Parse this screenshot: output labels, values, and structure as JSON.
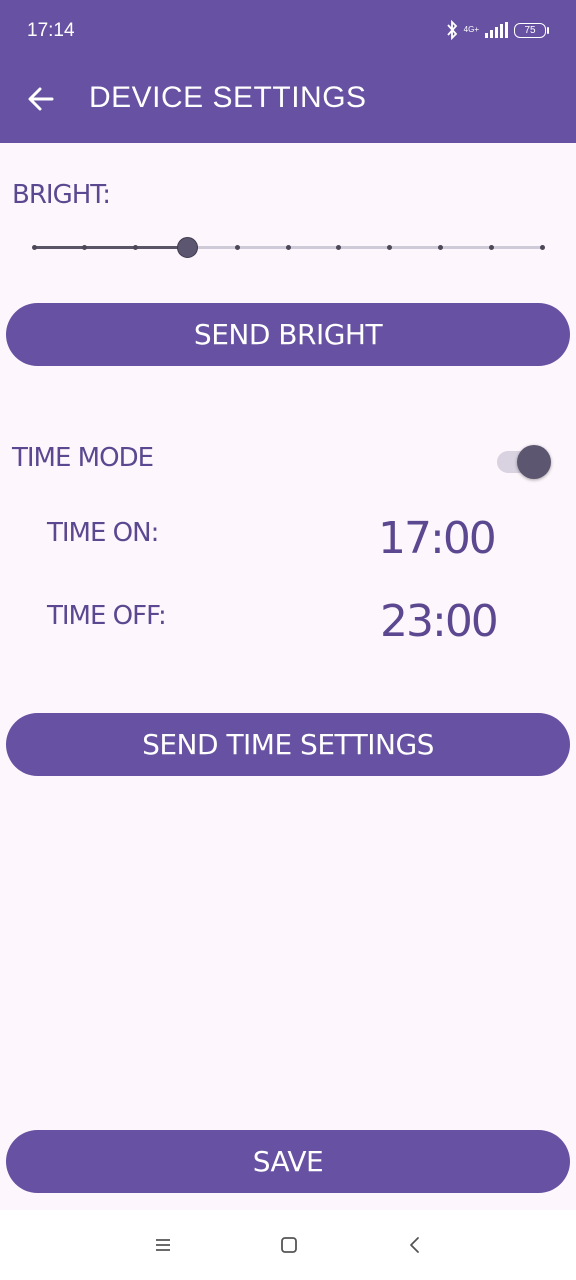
{
  "status_bar": {
    "time": "17:14",
    "network": "4G+",
    "battery": "75",
    "icons": [
      "bluetooth-icon",
      "signal-icon",
      "battery-icon"
    ]
  },
  "app_bar": {
    "title": "DEVICE SETTINGS",
    "back_icon": "arrow-left-icon"
  },
  "bright": {
    "label": "BRIGHT:",
    "steps": 11,
    "value_index": 3
  },
  "send_bright_button": "SEND BRIGHT",
  "time_mode": {
    "label": "TIME MODE",
    "enabled": true
  },
  "time_on": {
    "label": "TIME ON:",
    "value": "17:00"
  },
  "time_off": {
    "label": "TIME OFF:",
    "value": "23:00"
  },
  "send_time_button": "SEND TIME SETTINGS",
  "save_button": "SAVE",
  "nav_bar": {
    "icons": [
      "menu-icon",
      "home-icon",
      "back-icon"
    ]
  },
  "colors": {
    "primary": "#6751a2",
    "background": "#fdf6fc",
    "label_text": "#5b4890",
    "slider_active": "#5a5467"
  }
}
